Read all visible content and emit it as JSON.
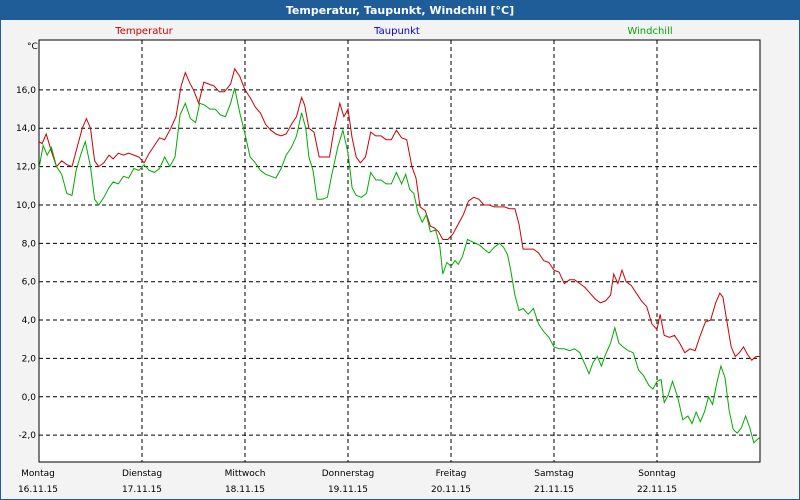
{
  "window": {
    "title": "Temperatur, Taupunkt, Windchill [°C]"
  },
  "colors": {
    "titlebar": "#1f5d99",
    "temperatur": "#cc0000",
    "taupunkt": "#0000cc",
    "windchill": "#00aa00",
    "grid": "#000000"
  },
  "chart_data": {
    "type": "line",
    "title": "Temperatur, Taupunkt, Windchill [°C]",
    "ylabel": "°C",
    "ylim": [
      -3.4,
      18.6
    ],
    "yticks": [
      "-2,0",
      "0,0",
      "2,0",
      "4,0",
      "6,0",
      "8,0",
      "10,0",
      "12,0",
      "14,0",
      "16,0"
    ],
    "ytick_values": [
      -2,
      0,
      2,
      4,
      6,
      8,
      10,
      12,
      14,
      16
    ],
    "xlim": [
      0,
      7
    ],
    "days": [
      {
        "day": "Montag",
        "date": "16.11.15"
      },
      {
        "day": "Dienstag",
        "date": "17.11.15"
      },
      {
        "day": "Mittwoch",
        "date": "18.11.15"
      },
      {
        "day": "Donnerstag",
        "date": "19.11.15"
      },
      {
        "day": "Freitag",
        "date": "20.11.15"
      },
      {
        "day": "Samstag",
        "date": "21.11.15"
      },
      {
        "day": "Sonntag",
        "date": "22.11.15"
      }
    ],
    "grid": true,
    "legend_position": "top",
    "series": [
      {
        "name": "Temperatur",
        "color": "#cc0000",
        "points": [
          [
            0.0,
            13.3
          ],
          [
            0.03,
            13.2
          ],
          [
            0.07,
            13.7
          ],
          [
            0.12,
            12.8
          ],
          [
            0.17,
            12.0
          ],
          [
            0.22,
            12.3
          ],
          [
            0.27,
            12.1
          ],
          [
            0.32,
            12.0
          ],
          [
            0.37,
            13.0
          ],
          [
            0.42,
            14.0
          ],
          [
            0.46,
            14.5
          ],
          [
            0.5,
            14.0
          ],
          [
            0.54,
            12.3
          ],
          [
            0.58,
            12.0
          ],
          [
            0.63,
            12.2
          ],
          [
            0.68,
            12.6
          ],
          [
            0.72,
            12.4
          ],
          [
            0.77,
            12.7
          ],
          [
            0.82,
            12.6
          ],
          [
            0.87,
            12.7
          ],
          [
            0.92,
            12.6
          ],
          [
            0.97,
            12.5
          ],
          [
            1.02,
            12.2
          ],
          [
            1.07,
            12.7
          ],
          [
            1.12,
            13.1
          ],
          [
            1.17,
            13.5
          ],
          [
            1.22,
            13.4
          ],
          [
            1.28,
            14.0
          ],
          [
            1.33,
            14.6
          ],
          [
            1.38,
            16.2
          ],
          [
            1.42,
            16.9
          ],
          [
            1.46,
            16.4
          ],
          [
            1.5,
            16.0
          ],
          [
            1.55,
            15.3
          ],
          [
            1.6,
            16.4
          ],
          [
            1.65,
            16.3
          ],
          [
            1.7,
            16.2
          ],
          [
            1.75,
            15.9
          ],
          [
            1.8,
            15.9
          ],
          [
            1.86,
            16.3
          ],
          [
            1.9,
            17.1
          ],
          [
            1.95,
            16.7
          ],
          [
            2.0,
            16.0
          ],
          [
            2.05,
            15.6
          ],
          [
            2.1,
            15.1
          ],
          [
            2.15,
            14.8
          ],
          [
            2.2,
            14.2
          ],
          [
            2.25,
            13.9
          ],
          [
            2.3,
            13.7
          ],
          [
            2.35,
            13.6
          ],
          [
            2.4,
            13.7
          ],
          [
            2.45,
            14.2
          ],
          [
            2.5,
            14.6
          ],
          [
            2.55,
            15.6
          ],
          [
            2.58,
            15.2
          ],
          [
            2.62,
            14.0
          ],
          [
            2.67,
            13.8
          ],
          [
            2.72,
            12.5
          ],
          [
            2.78,
            12.5
          ],
          [
            2.82,
            12.5
          ],
          [
            2.86,
            13.8
          ],
          [
            2.92,
            15.3
          ],
          [
            2.96,
            14.6
          ],
          [
            3.0,
            15.0
          ],
          [
            3.04,
            13.5
          ],
          [
            3.08,
            12.5
          ],
          [
            3.12,
            12.2
          ],
          [
            3.17,
            12.5
          ],
          [
            3.22,
            13.8
          ],
          [
            3.27,
            13.6
          ],
          [
            3.32,
            13.6
          ],
          [
            3.37,
            13.4
          ],
          [
            3.42,
            13.4
          ],
          [
            3.47,
            13.9
          ],
          [
            3.52,
            13.5
          ],
          [
            3.57,
            13.4
          ],
          [
            3.62,
            12.0
          ],
          [
            3.66,
            11.4
          ],
          [
            3.7,
            9.9
          ],
          [
            3.75,
            9.7
          ],
          [
            3.8,
            8.9
          ],
          [
            3.84,
            8.8
          ],
          [
            3.88,
            8.6
          ],
          [
            3.92,
            8.2
          ],
          [
            3.97,
            8.2
          ],
          [
            4.02,
            8.5
          ],
          [
            4.07,
            9.0
          ],
          [
            4.12,
            9.5
          ],
          [
            4.17,
            10.2
          ],
          [
            4.22,
            10.4
          ],
          [
            4.27,
            10.3
          ],
          [
            4.32,
            10.0
          ],
          [
            4.37,
            10.0
          ],
          [
            4.42,
            9.9
          ],
          [
            4.47,
            9.9
          ],
          [
            4.52,
            9.9
          ],
          [
            4.57,
            9.8
          ],
          [
            4.62,
            9.8
          ],
          [
            4.66,
            9.0
          ],
          [
            4.7,
            7.7
          ],
          [
            4.75,
            7.7
          ],
          [
            4.8,
            7.7
          ],
          [
            4.85,
            7.5
          ],
          [
            4.9,
            7.1
          ],
          [
            4.95,
            7.0
          ],
          [
            5.0,
            6.6
          ],
          [
            5.05,
            6.5
          ],
          [
            5.1,
            5.9
          ],
          [
            5.15,
            6.1
          ],
          [
            5.2,
            6.1
          ],
          [
            5.25,
            5.9
          ],
          [
            5.3,
            5.7
          ],
          [
            5.35,
            5.4
          ],
          [
            5.4,
            5.1
          ],
          [
            5.45,
            4.9
          ],
          [
            5.5,
            5.0
          ],
          [
            5.55,
            5.3
          ],
          [
            5.58,
            6.4
          ],
          [
            5.62,
            5.9
          ],
          [
            5.66,
            6.6
          ],
          [
            5.7,
            6.0
          ],
          [
            5.75,
            5.8
          ],
          [
            5.8,
            5.4
          ],
          [
            5.85,
            5.0
          ],
          [
            5.9,
            4.7
          ],
          [
            5.95,
            3.8
          ],
          [
            6.0,
            3.5
          ],
          [
            6.03,
            4.3
          ],
          [
            6.07,
            3.2
          ],
          [
            6.12,
            3.1
          ],
          [
            6.17,
            3.2
          ],
          [
            6.22,
            2.8
          ],
          [
            6.27,
            2.3
          ],
          [
            6.32,
            2.5
          ],
          [
            6.37,
            2.4
          ],
          [
            6.42,
            3.2
          ],
          [
            6.47,
            3.9
          ],
          [
            6.52,
            4.0
          ],
          [
            6.57,
            4.9
          ],
          [
            6.61,
            5.4
          ],
          [
            6.64,
            5.2
          ],
          [
            6.68,
            3.9
          ],
          [
            6.72,
            2.6
          ],
          [
            6.76,
            2.1
          ],
          [
            6.8,
            2.3
          ],
          [
            6.84,
            2.6
          ],
          [
            6.88,
            2.2
          ],
          [
            6.92,
            1.9
          ],
          [
            6.96,
            2.1
          ],
          [
            7.0,
            2.1
          ]
        ]
      },
      {
        "name": "Taupunkt",
        "color": "#0000cc",
        "points": []
      },
      {
        "name": "Windchill",
        "color": "#00aa00",
        "points": [
          [
            0.0,
            11.9
          ],
          [
            0.04,
            13.1
          ],
          [
            0.08,
            12.6
          ],
          [
            0.12,
            13.0
          ],
          [
            0.17,
            12.0
          ],
          [
            0.22,
            11.6
          ],
          [
            0.27,
            10.6
          ],
          [
            0.32,
            10.5
          ],
          [
            0.36,
            11.8
          ],
          [
            0.41,
            12.7
          ],
          [
            0.45,
            13.3
          ],
          [
            0.5,
            12.0
          ],
          [
            0.54,
            10.3
          ],
          [
            0.58,
            10.0
          ],
          [
            0.63,
            10.4
          ],
          [
            0.68,
            10.9
          ],
          [
            0.72,
            11.2
          ],
          [
            0.77,
            11.1
          ],
          [
            0.82,
            11.5
          ],
          [
            0.87,
            11.4
          ],
          [
            0.92,
            11.9
          ],
          [
            0.97,
            11.8
          ],
          [
            1.02,
            12.1
          ],
          [
            1.07,
            11.8
          ],
          [
            1.12,
            11.7
          ],
          [
            1.17,
            11.9
          ],
          [
            1.22,
            12.5
          ],
          [
            1.27,
            12.0
          ],
          [
            1.32,
            12.5
          ],
          [
            1.37,
            14.7
          ],
          [
            1.42,
            15.3
          ],
          [
            1.47,
            14.5
          ],
          [
            1.52,
            14.3
          ],
          [
            1.56,
            15.3
          ],
          [
            1.61,
            15.2
          ],
          [
            1.66,
            15.0
          ],
          [
            1.71,
            15.0
          ],
          [
            1.76,
            14.7
          ],
          [
            1.81,
            14.6
          ],
          [
            1.86,
            15.3
          ],
          [
            1.9,
            16.1
          ],
          [
            1.95,
            14.8
          ],
          [
            2.0,
            13.7
          ],
          [
            2.05,
            12.5
          ],
          [
            2.1,
            12.2
          ],
          [
            2.15,
            11.8
          ],
          [
            2.2,
            11.6
          ],
          [
            2.25,
            11.5
          ],
          [
            2.3,
            11.4
          ],
          [
            2.35,
            11.9
          ],
          [
            2.4,
            12.6
          ],
          [
            2.45,
            13.0
          ],
          [
            2.5,
            13.6
          ],
          [
            2.55,
            14.8
          ],
          [
            2.59,
            14.0
          ],
          [
            2.62,
            12.5
          ],
          [
            2.66,
            11.8
          ],
          [
            2.7,
            10.3
          ],
          [
            2.75,
            10.3
          ],
          [
            2.8,
            10.4
          ],
          [
            2.84,
            11.5
          ],
          [
            2.9,
            13.0
          ],
          [
            2.95,
            13.9
          ],
          [
            3.0,
            12.7
          ],
          [
            3.04,
            10.9
          ],
          [
            3.08,
            10.5
          ],
          [
            3.13,
            10.4
          ],
          [
            3.18,
            10.6
          ],
          [
            3.22,
            11.7
          ],
          [
            3.27,
            11.3
          ],
          [
            3.32,
            11.3
          ],
          [
            3.37,
            11.1
          ],
          [
            3.42,
            11.1
          ],
          [
            3.47,
            11.7
          ],
          [
            3.52,
            11.1
          ],
          [
            3.56,
            11.6
          ],
          [
            3.6,
            10.8
          ],
          [
            3.64,
            10.6
          ],
          [
            3.68,
            9.6
          ],
          [
            3.72,
            9.1
          ],
          [
            3.76,
            9.5
          ],
          [
            3.8,
            8.6
          ],
          [
            3.85,
            8.7
          ],
          [
            3.89,
            7.9
          ],
          [
            3.92,
            6.4
          ],
          [
            3.96,
            7.0
          ],
          [
            4.0,
            6.8
          ],
          [
            4.04,
            7.1
          ],
          [
            4.07,
            6.9
          ],
          [
            4.11,
            7.3
          ],
          [
            4.16,
            8.2
          ],
          [
            4.2,
            8.1
          ],
          [
            4.24,
            8.0
          ],
          [
            4.28,
            7.9
          ],
          [
            4.32,
            7.7
          ],
          [
            4.37,
            7.5
          ],
          [
            4.42,
            7.8
          ],
          [
            4.47,
            8.0
          ],
          [
            4.51,
            7.8
          ],
          [
            4.55,
            7.4
          ],
          [
            4.58,
            6.6
          ],
          [
            4.62,
            5.3
          ],
          [
            4.66,
            4.5
          ],
          [
            4.7,
            4.6
          ],
          [
            4.75,
            4.3
          ],
          [
            4.8,
            4.6
          ],
          [
            4.85,
            3.8
          ],
          [
            4.9,
            3.4
          ],
          [
            4.95,
            3.1
          ],
          [
            5.0,
            2.6
          ],
          [
            5.05,
            2.5
          ],
          [
            5.1,
            2.5
          ],
          [
            5.15,
            2.4
          ],
          [
            5.2,
            2.5
          ],
          [
            5.25,
            2.3
          ],
          [
            5.3,
            1.7
          ],
          [
            5.34,
            1.2
          ],
          [
            5.38,
            1.8
          ],
          [
            5.42,
            2.1
          ],
          [
            5.46,
            1.6
          ],
          [
            5.5,
            2.2
          ],
          [
            5.55,
            2.8
          ],
          [
            5.59,
            3.6
          ],
          [
            5.63,
            2.8
          ],
          [
            5.67,
            2.6
          ],
          [
            5.72,
            2.4
          ],
          [
            5.77,
            2.3
          ],
          [
            5.82,
            1.4
          ],
          [
            5.87,
            1.1
          ],
          [
            5.92,
            0.6
          ],
          [
            5.96,
            0.4
          ],
          [
            6.0,
            0.8
          ],
          [
            6.04,
            0.9
          ],
          [
            6.07,
            -0.3
          ],
          [
            6.11,
            0.1
          ],
          [
            6.15,
            0.8
          ],
          [
            6.2,
            0.0
          ],
          [
            6.25,
            -1.2
          ],
          [
            6.3,
            -1.0
          ],
          [
            6.34,
            -1.4
          ],
          [
            6.38,
            -0.8
          ],
          [
            6.42,
            -1.3
          ],
          [
            6.46,
            -0.8
          ],
          [
            6.5,
            0.0
          ],
          [
            6.54,
            -0.4
          ],
          [
            6.58,
            0.7
          ],
          [
            6.62,
            1.6
          ],
          [
            6.66,
            1.0
          ],
          [
            6.7,
            -0.7
          ],
          [
            6.74,
            -1.7
          ],
          [
            6.78,
            -1.9
          ],
          [
            6.82,
            -1.6
          ],
          [
            6.86,
            -1.0
          ],
          [
            6.9,
            -1.6
          ],
          [
            6.94,
            -2.4
          ],
          [
            6.98,
            -2.2
          ],
          [
            7.0,
            -2.1
          ]
        ]
      }
    ]
  }
}
